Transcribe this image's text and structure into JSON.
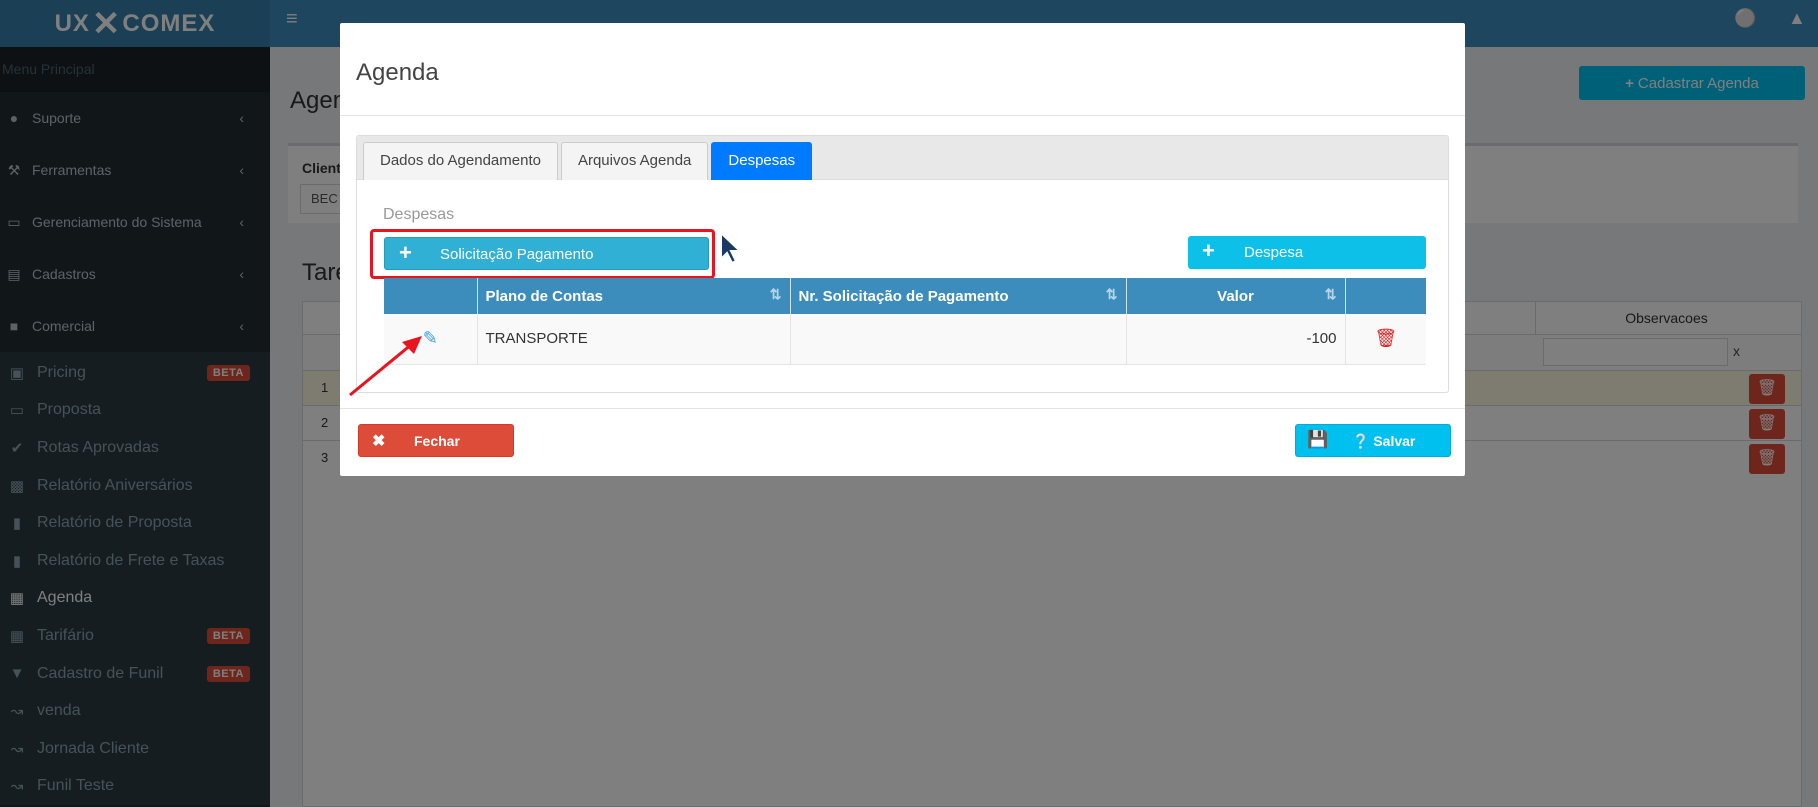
{
  "app": {
    "logo_left": "UX",
    "logo_mid": "✕",
    "logo_right": "COMEX"
  },
  "sidebar": {
    "header": "Menu Principal",
    "groups": [
      {
        "label": "Suporte",
        "icon": "globe-icon"
      },
      {
        "label": "Ferramentas",
        "icon": "wrench-icon"
      },
      {
        "label": "Gerenciamento do Sistema",
        "icon": "laptop-icon"
      },
      {
        "label": "Cadastros",
        "icon": "book-icon"
      },
      {
        "label": "Comercial",
        "icon": "briefcase-icon"
      }
    ],
    "items": [
      {
        "label": "Pricing",
        "icon": "money-icon",
        "badge": "BETA"
      },
      {
        "label": "Proposta",
        "icon": "file-icon",
        "badge": ""
      },
      {
        "label": "Rotas Aprovadas",
        "icon": "check-circle-icon",
        "badge": ""
      },
      {
        "label": "Relatório Aniversários",
        "icon": "industry-icon",
        "badge": ""
      },
      {
        "label": "Relatório de Proposta",
        "icon": "bar-chart-icon",
        "badge": ""
      },
      {
        "label": "Relatório de Frete e Taxas",
        "icon": "bar-chart-icon",
        "badge": ""
      },
      {
        "label": "Agenda",
        "icon": "calendar-icon",
        "badge": ""
      },
      {
        "label": "Tarifário",
        "icon": "table-icon",
        "badge": "BETA"
      },
      {
        "label": "Cadastro de Funil",
        "icon": "filter-icon",
        "badge": "BETA"
      },
      {
        "label": "venda",
        "icon": "line-chart-icon",
        "badge": ""
      },
      {
        "label": "Jornada Cliente",
        "icon": "line-chart-icon",
        "badge": ""
      },
      {
        "label": "Funil Teste",
        "icon": "line-chart-icon",
        "badge": ""
      }
    ]
  },
  "page": {
    "title": "Agen",
    "cadastrar_button": "Cadastrar Agenda",
    "filter_label": "Client",
    "filter_value": "BEC",
    "tarefas_title": "Tare",
    "col_observacoes": "Observacoes",
    "filter_clear": "x",
    "rows": [
      "1",
      "2",
      "3"
    ]
  },
  "modal": {
    "title": "Agenda",
    "tabs": [
      {
        "label": "Dados do Agendamento",
        "active": false
      },
      {
        "label": "Arquivos Agenda",
        "active": false
      },
      {
        "label": "Despesas",
        "active": true
      }
    ],
    "section_title": "Despesas",
    "solicitacao_button": "Solicitação Pagamento",
    "despesa_button": "Despesa",
    "table": {
      "columns": [
        "",
        "Plano de Contas",
        "Nr. Solicitação de Pagamento",
        "Valor",
        ""
      ],
      "rows": [
        {
          "plano": "TRANSPORTE",
          "nr": "",
          "valor": "-100"
        }
      ]
    },
    "fechar_button": "Fechar",
    "salvar_button": "Salvar"
  },
  "colors": {
    "primary": "#3c8dbc",
    "info": "#00c0ef",
    "danger": "#dd4b39",
    "highlight": "#e8141f",
    "tab_active": "#007bff"
  }
}
